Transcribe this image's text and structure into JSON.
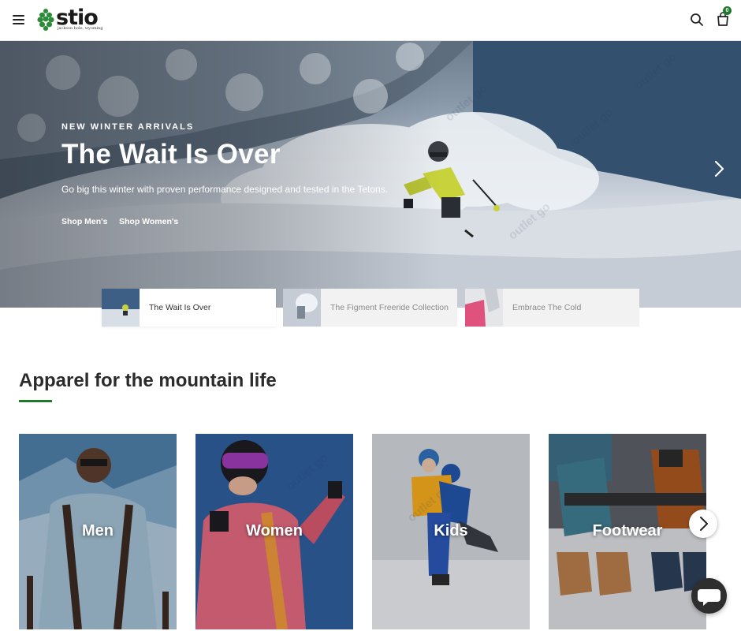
{
  "header": {
    "logo_text": "stio",
    "logo_tagline": "jackson hole, wyoming",
    "cart_count": "0",
    "icons": {
      "menu": "hamburger-icon",
      "search": "search-icon",
      "cart": "shopping-bag-icon"
    },
    "accent_color": "#1f7a2e"
  },
  "hero": {
    "eyebrow": "NEW WINTER ARRIVALS",
    "title": "The Wait Is Over",
    "subtitle": "Go big this winter with proven performance designed and tested in the Tetons.",
    "links": [
      "Shop Men's",
      "Shop Women's"
    ],
    "next_icon": "chevron-right-icon"
  },
  "slides": [
    {
      "label": "The Wait Is Over",
      "active": true
    },
    {
      "label": "The Figment Freeride Collection",
      "active": false
    },
    {
      "label": "Embrace The Cold",
      "active": false
    }
  ],
  "section": {
    "title": "Apparel for the mountain life"
  },
  "categories": [
    {
      "label": "Men"
    },
    {
      "label": "Women"
    },
    {
      "label": "Kids"
    },
    {
      "label": "Footwear"
    }
  ],
  "carousel": {
    "next_icon": "chevron-right-icon"
  },
  "chat": {
    "icon": "chat-bubble-icon"
  },
  "watermark": "outlet go"
}
